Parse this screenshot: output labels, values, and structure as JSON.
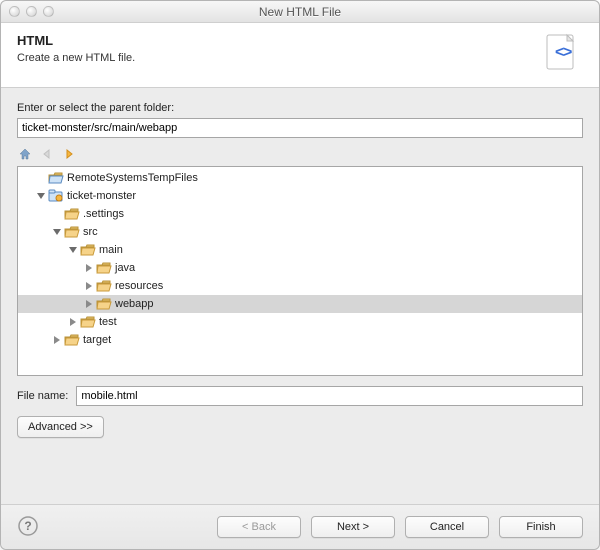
{
  "window": {
    "title": "New HTML File"
  },
  "header": {
    "heading": "HTML",
    "subheading": "Create a new HTML file."
  },
  "form": {
    "parent_label": "Enter or select the parent folder:",
    "parent_value": "ticket-monster/src/main/webapp",
    "filename_label": "File name:",
    "filename_value": "mobile.html",
    "advanced_label": "Advanced >>"
  },
  "tree": {
    "nodes": [
      {
        "id": "remote",
        "label": "RemoteSystemsTempFiles",
        "depth": 1,
        "twisty": "none",
        "icon": "folder-open-blue",
        "selected": false
      },
      {
        "id": "ticket",
        "label": "ticket-monster",
        "depth": 1,
        "twisty": "down",
        "icon": "project",
        "selected": false
      },
      {
        "id": "settings",
        "label": ".settings",
        "depth": 2,
        "twisty": "none",
        "icon": "folder-open",
        "selected": false
      },
      {
        "id": "src",
        "label": "src",
        "depth": 2,
        "twisty": "down",
        "icon": "folder-open",
        "selected": false
      },
      {
        "id": "main",
        "label": "main",
        "depth": 3,
        "twisty": "down",
        "icon": "folder-open",
        "selected": false
      },
      {
        "id": "java",
        "label": "java",
        "depth": 4,
        "twisty": "right",
        "icon": "folder-open",
        "selected": false
      },
      {
        "id": "resources",
        "label": "resources",
        "depth": 4,
        "twisty": "right",
        "icon": "folder-open",
        "selected": false
      },
      {
        "id": "webapp",
        "label": "webapp",
        "depth": 4,
        "twisty": "right",
        "icon": "folder-open",
        "selected": true
      },
      {
        "id": "test",
        "label": "test",
        "depth": 3,
        "twisty": "right",
        "icon": "folder-open",
        "selected": false
      },
      {
        "id": "target",
        "label": "target",
        "depth": 2,
        "twisty": "right",
        "icon": "folder-open",
        "selected": false
      }
    ]
  },
  "buttons": {
    "back": "< Back",
    "next": "Next >",
    "cancel": "Cancel",
    "finish": "Finish"
  },
  "icons": {
    "home": "home-icon",
    "back": "back-arrow-icon",
    "forward": "forward-arrow-icon",
    "help": "help-icon",
    "page": "html-page-icon"
  }
}
